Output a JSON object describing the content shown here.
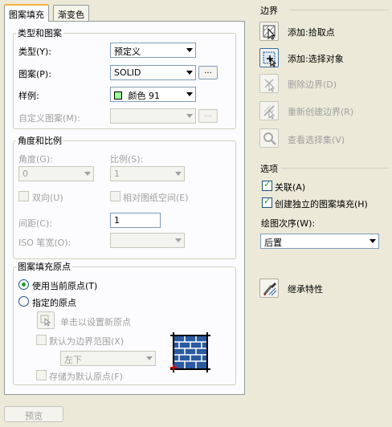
{
  "tabs": [
    {
      "label": "图案填充",
      "active": true
    },
    {
      "label": "渐变色",
      "active": false
    }
  ],
  "type_group": {
    "title": "类型和图案",
    "type_label": "类型(Y):",
    "type_value": "预定义",
    "pattern_label": "图案(P):",
    "pattern_value": "SOLID",
    "swatch_label": "样例:",
    "swatch_value": "颜色 91",
    "swatch_color": "#99ff99",
    "custom_label": "自定义图案(M):",
    "ellipsis": "..."
  },
  "angle_group": {
    "title": "角度和比例",
    "angle_label": "角度(G):",
    "angle_value": "0",
    "scale_label": "比例(S):",
    "scale_value": "1",
    "double_label": "双向(U)",
    "relative_label": "相对图纸空间(E)",
    "spacing_label": "间距(C):",
    "spacing_value": "1",
    "iso_label": "ISO 笔宽(O):"
  },
  "origin_group": {
    "title": "图案填充原点",
    "use_current": "使用当前原点(T)",
    "specified": "指定的原点",
    "click_set": "单击以设置新原点",
    "default_extent": "默认为边界范围(X)",
    "extent_value": "左下",
    "store_default": "存储为默认原点(F)"
  },
  "boundary": {
    "title": "边界",
    "add_pick": "添加:拾取点",
    "add_select": "添加:选择对象",
    "remove": "删除边界(D)",
    "recreate": "重新创建边界(R)",
    "view_select": "查看选择集(V)"
  },
  "options": {
    "title": "选项",
    "associative": "关联(A)",
    "independent": "创建独立的图案填充(H)",
    "draw_order_label": "绘图次序(W):",
    "draw_order_value": "后置"
  },
  "inherit": "继承特性",
  "preview": "预览",
  "colors": {
    "dialog_bg": "#ece9d8",
    "panel_bg": "#fcfcfe",
    "disabled_text": "#a0a0a0",
    "check_green": "#21a121"
  }
}
